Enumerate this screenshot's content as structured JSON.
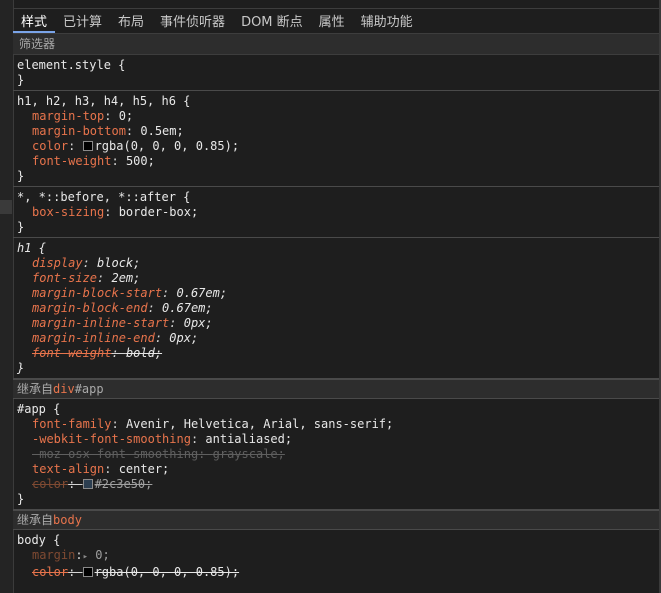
{
  "tabs": [
    "样式",
    "已计算",
    "布局",
    "事件侦听器",
    "DOM 断点",
    "属性",
    "辅助功能"
  ],
  "filter": {
    "label": "筛选器"
  },
  "rules": {
    "element_style": {
      "selector": "element.style {",
      "close": "}"
    },
    "headings": {
      "selector": "h1, h2, h3, h4, h5, h6 {",
      "decls": [
        {
          "prop": "margin-top",
          "val": "0;"
        },
        {
          "prop": "margin-bottom",
          "val": "0.5em;"
        },
        {
          "prop": "color",
          "val": "rgba(0, 0, 0, 0.85);",
          "swatch": "#000000"
        },
        {
          "prop": "font-weight",
          "val": "500;"
        }
      ],
      "close": "}"
    },
    "universal": {
      "selector": "*, *::before, *::after {",
      "decls": [
        {
          "prop": "box-sizing",
          "val": "border-box;"
        }
      ],
      "close": "}"
    },
    "h1_ua": {
      "selector": "h1 {",
      "decls": [
        {
          "prop": "display",
          "val": "block;"
        },
        {
          "prop": "font-size",
          "val": "2em;"
        },
        {
          "prop": "margin-block-start",
          "val": "0.67em;"
        },
        {
          "prop": "margin-block-end",
          "val": "0.67em;"
        },
        {
          "prop": "margin-inline-start",
          "val": "0px;"
        },
        {
          "prop": "margin-inline-end",
          "val": "0px;"
        },
        {
          "prop": "font-weight",
          "val": "bold;",
          "struck": true
        }
      ],
      "close": "}"
    },
    "inherit_app": {
      "label": "继承自",
      "tag": "div",
      "id": "#app"
    },
    "app": {
      "selector": "#app {",
      "decls": [
        {
          "prop": "font-family",
          "val": "Avenir, Helvetica, Arial, sans-serif;"
        },
        {
          "prop": "-webkit-font-smoothing",
          "val": "antialiased;"
        },
        {
          "prop": "-moz-osx-font-smoothing",
          "val": "grayscale;",
          "disabled": true
        },
        {
          "prop": "text-align",
          "val": "center;"
        },
        {
          "prop": "color",
          "val": "#2c3e50;",
          "swatch": "#2c3e50",
          "struck": true
        }
      ],
      "close": "}"
    },
    "inherit_body": {
      "label": "继承自",
      "tag": "body"
    },
    "body": {
      "selector": "body {",
      "decls": [
        {
          "prop": "margin",
          "val": "0;",
          "arrow": "▸"
        },
        {
          "prop": "color",
          "val": "rgba(0, 0, 0, 0.85);",
          "swatch": "#000000",
          "struck": true
        }
      ]
    }
  }
}
